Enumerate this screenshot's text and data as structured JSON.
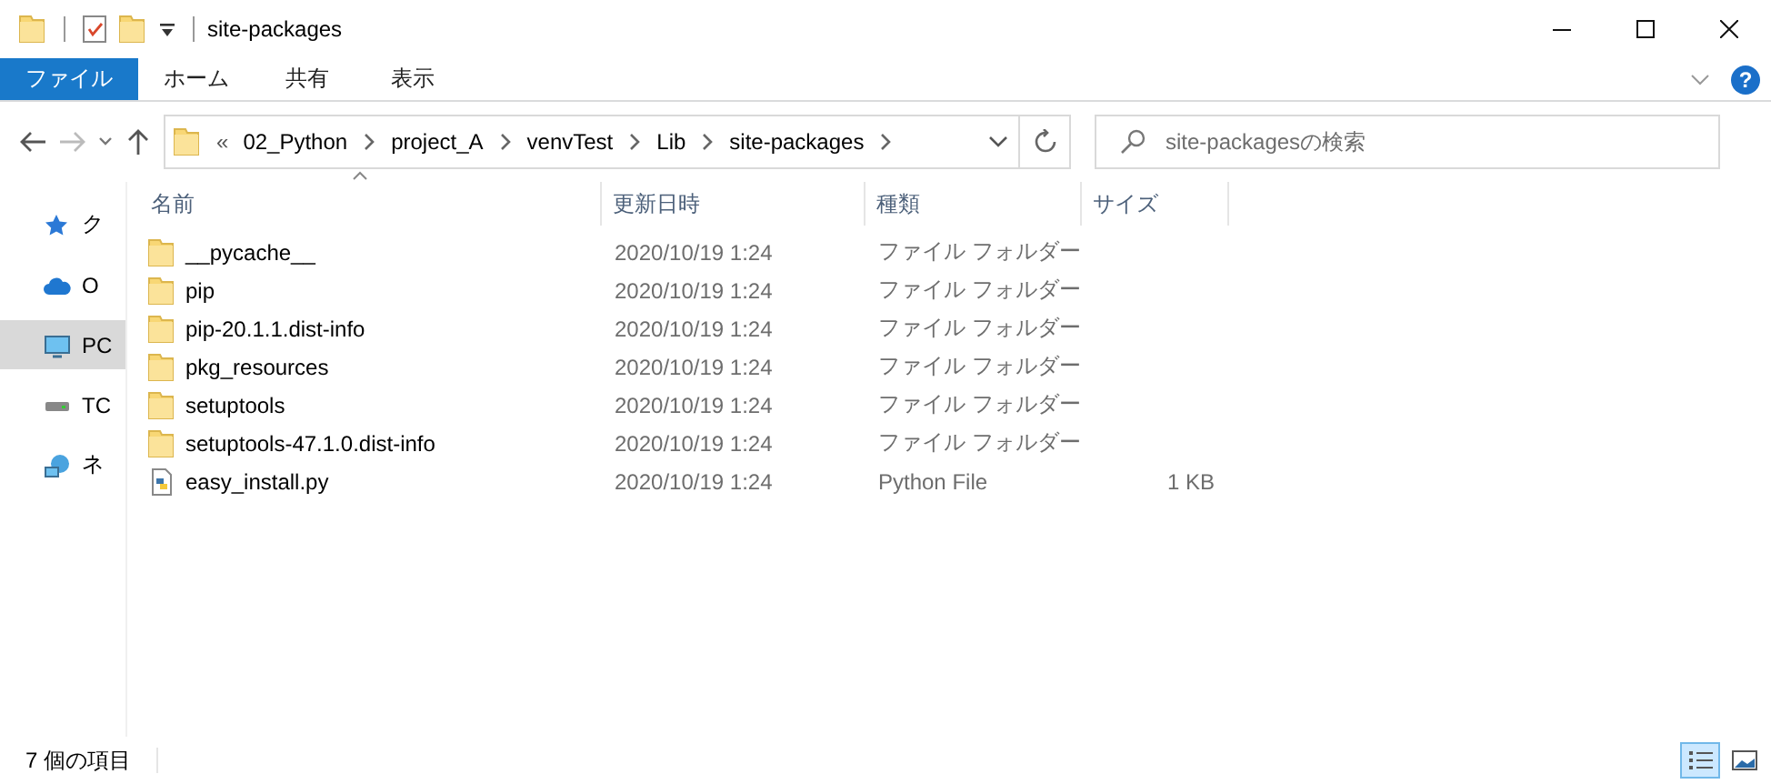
{
  "window": {
    "title": "site-packages"
  },
  "ribbon": {
    "tabs": [
      {
        "label": "ファイル",
        "selected": true
      },
      {
        "label": "ホーム",
        "selected": false
      },
      {
        "label": "共有",
        "selected": false
      },
      {
        "label": "表示",
        "selected": false
      }
    ],
    "help": "?"
  },
  "address_bar": {
    "overflow": "«",
    "path": [
      "02_Python",
      "project_A",
      "venvTest",
      "Lib",
      "site-packages"
    ]
  },
  "search": {
    "placeholder": "site-packagesの検索"
  },
  "sidebar": {
    "items": [
      {
        "label": "ク",
        "kind": "star",
        "selected": false
      },
      {
        "label": "O",
        "kind": "cloud",
        "selected": false
      },
      {
        "label": "PC",
        "kind": "pc",
        "selected": true
      },
      {
        "label": "TC",
        "kind": "drive",
        "selected": false
      },
      {
        "label": "ネ",
        "kind": "network",
        "selected": false
      }
    ]
  },
  "table": {
    "columns": [
      {
        "label": "名前",
        "sorted": true
      },
      {
        "label": "更新日時",
        "sorted": false
      },
      {
        "label": "種類",
        "sorted": false
      },
      {
        "label": "サイズ",
        "sorted": false
      }
    ],
    "rows": [
      {
        "kind": "folder",
        "name": "__pycache__",
        "modified": "2020/10/19 1:24",
        "type": "ファイル フォルダー"
      },
      {
        "kind": "folder",
        "name": "pip",
        "modified": "2020/10/19 1:24",
        "type": "ファイル フォルダー"
      },
      {
        "kind": "folder",
        "name": "pip-20.1.1.dist-info",
        "modified": "2020/10/19 1:24",
        "type": "ファイル フォルダー"
      },
      {
        "kind": "folder",
        "name": "pkg_resources",
        "modified": "2020/10/19 1:24",
        "type": "ファイル フォルダー"
      },
      {
        "kind": "folder",
        "name": "setuptools",
        "modified": "2020/10/19 1:24",
        "type": "ファイル フォルダー"
      },
      {
        "kind": "folder",
        "name": "setuptools-47.1.0.dist-info",
        "modified": "2020/10/19 1:24",
        "type": "ファイル フォルダー"
      },
      {
        "kind": "python",
        "name": "easy_install.py",
        "modified": "2020/10/19 1:24",
        "type": "Python File",
        "size": "1 KB"
      }
    ]
  },
  "status_bar": {
    "count": "7 個の項目",
    "views": [
      {
        "kind": "details",
        "selected": true
      },
      {
        "kind": "large",
        "selected": false
      }
    ]
  }
}
